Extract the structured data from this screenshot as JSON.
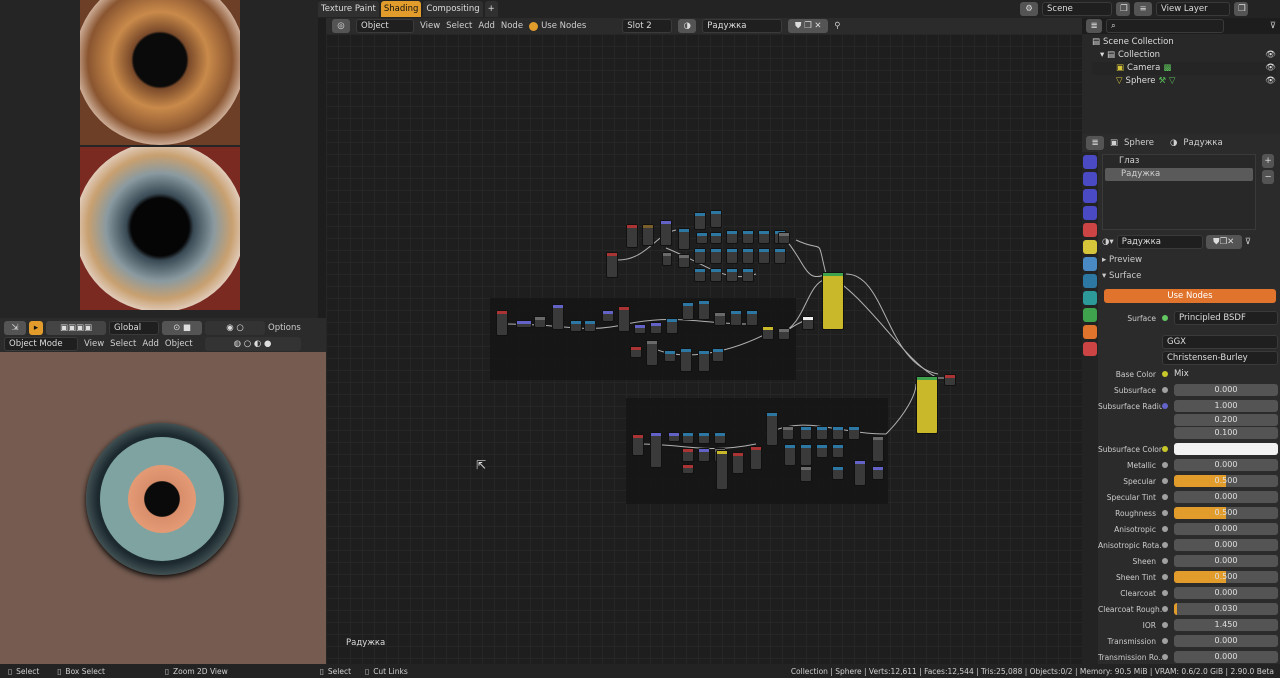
{
  "workspace_tabs": [
    {
      "label": "Texture Paint",
      "active": false
    },
    {
      "label": "Shading",
      "active": true
    },
    {
      "label": "Compositing",
      "active": false
    }
  ],
  "top_right": {
    "scene": "Scene",
    "view_layer": "View Layer"
  },
  "viewport": {
    "transform": "Global",
    "options": "Options",
    "mode": "Object Mode",
    "menu": [
      "View",
      "Select",
      "Add",
      "Object"
    ]
  },
  "node_editor": {
    "object": "Object",
    "menu": [
      "View",
      "Select",
      "Add",
      "Node"
    ],
    "use_nodes": "Use Nodes",
    "slot": "Slot 2",
    "material": "Радужка",
    "footer_label": "Радужка"
  },
  "outliner": {
    "items": [
      {
        "label": "Scene Collection",
        "indent": 0
      },
      {
        "label": "Collection",
        "indent": 1
      },
      {
        "label": "Camera",
        "indent": 2
      },
      {
        "label": "Sphere",
        "indent": 2
      }
    ]
  },
  "properties": {
    "object": "Sphere",
    "material": "Радужка",
    "slots": [
      "Глаз",
      "Радужка"
    ],
    "material_name": "Радужка",
    "panels": {
      "preview": "Preview",
      "surface": "Surface"
    },
    "use_nodes": "Use Nodes",
    "surface_label": "Surface",
    "surface_value": "Principled BSDF",
    "distribution": "GGX",
    "sss_method": "Christensen-Burley",
    "base_color_label": "Base Color",
    "base_color_value": "Mix",
    "fields": [
      {
        "label": "Subsurface",
        "value": "0.000",
        "fill": 0
      },
      {
        "label": "Subsurface Radius",
        "value": "1.000",
        "fill": 0
      },
      {
        "label": "",
        "value": "0.200",
        "fill": 0
      },
      {
        "label": "",
        "value": "0.100",
        "fill": 0
      },
      {
        "label": "Subsurface Color",
        "value": "",
        "fill": 0
      },
      {
        "label": "Metallic",
        "value": "0.000",
        "fill": 0
      },
      {
        "label": "Specular",
        "value": "0.500",
        "fill": 0.5
      },
      {
        "label": "Specular Tint",
        "value": "0.000",
        "fill": 0
      },
      {
        "label": "Roughness",
        "value": "0.500",
        "fill": 0.5
      },
      {
        "label": "Anisotropic",
        "value": "0.000",
        "fill": 0
      },
      {
        "label": "Anisotropic Rota...",
        "value": "0.000",
        "fill": 0
      },
      {
        "label": "Sheen",
        "value": "0.000",
        "fill": 0
      },
      {
        "label": "Sheen Tint",
        "value": "0.500",
        "fill": 0.5
      },
      {
        "label": "Clearcoat",
        "value": "0.000",
        "fill": 0
      },
      {
        "label": "Clearcoat Rough...",
        "value": "0.030",
        "fill": 0.03
      },
      {
        "label": "IOR",
        "value": "1.450",
        "fill": 0
      },
      {
        "label": "Transmission",
        "value": "0.000",
        "fill": 0
      },
      {
        "label": "Transmission Ro...",
        "value": "0.000",
        "fill": 0
      }
    ]
  },
  "status": {
    "left": [
      "Select",
      "Box Select",
      "Zoom 2D View",
      "Select",
      "Cut Links"
    ],
    "info": "Collection | Sphere | Verts:12,611 | Faces:12,544 | Tris:25,088 | Objects:0/2 | Memory: 90.5 MiB | VRAM: 0.6/2.0 GiB | 2.90.0 Beta"
  },
  "colors": {
    "accent": "#e19c2c",
    "shader_node": "#3fa34d",
    "texture_node": "#7a5e2a",
    "converter_node": "#2d77a3"
  }
}
